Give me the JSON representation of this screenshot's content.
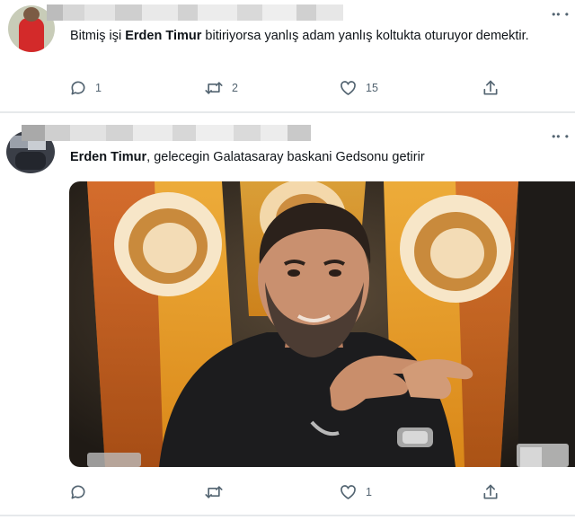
{
  "tweets": [
    {
      "text_pre": "Bitmiş işi ",
      "text_bold": "Erden Timur",
      "text_post": " bitiriyorsa yanlış adam yanlış koltukta oturuyor demektir.",
      "reply_count": "1",
      "retweet_count": "2",
      "like_count": "15",
      "more_menu": "•• •"
    },
    {
      "text_bold": "Erden Timur",
      "text_post": ", gelecegin Galatasaray baskani Gedsonu getirir",
      "reply_count": "",
      "retweet_count": "",
      "like_count": "1",
      "more_menu": "•• •"
    }
  ],
  "icons": {
    "reply": "reply-icon",
    "retweet": "retweet-icon",
    "like": "like-icon",
    "share": "share-icon"
  },
  "colors": {
    "icon_gray": "#536471",
    "text": "#0f1419",
    "divider": "#e6e9eb",
    "flag_yellow": "#f0a626",
    "flag_red": "#b5301d"
  }
}
